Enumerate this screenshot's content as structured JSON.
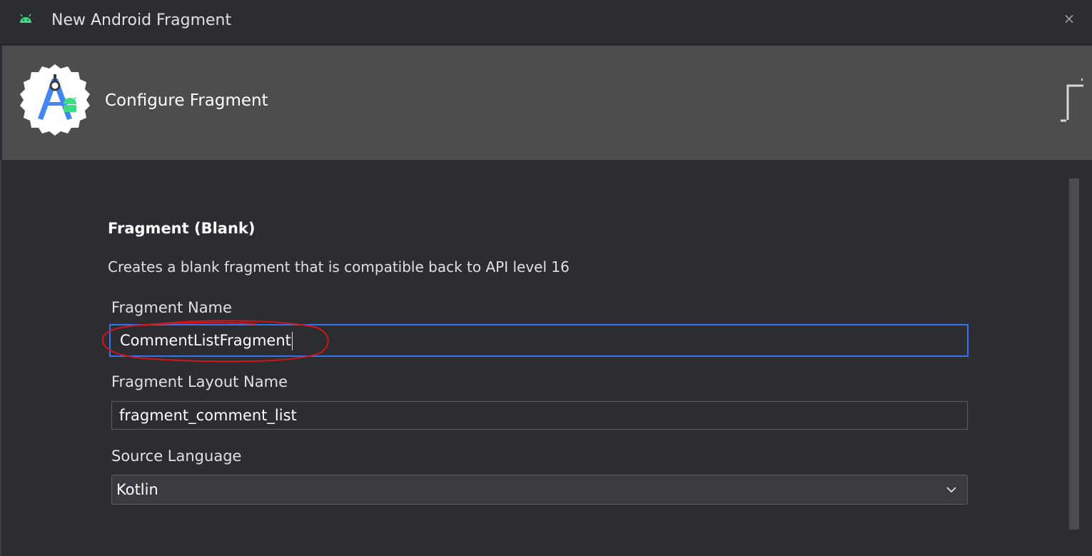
{
  "window": {
    "title": "New Android Fragment",
    "close_glyph": "×",
    "icon": "android-icon"
  },
  "banner": {
    "heading": "Configure Fragment",
    "logo": "android-studio-logo"
  },
  "template": {
    "title": "Fragment (Blank)",
    "description": "Creates a blank fragment that is compatible back to API level 16"
  },
  "form": {
    "fragment_name": {
      "label": "Fragment Name",
      "value": "CommentListFragment"
    },
    "layout_name": {
      "label": "Fragment Layout Name",
      "value": "fragment_comment_list"
    },
    "source_language": {
      "label": "Source Language",
      "selected": "Kotlin"
    }
  },
  "colors": {
    "background": "#2b2d30",
    "banner": "#4d4d4d",
    "focus": "#3574f0",
    "annotation": "#d0161b",
    "android_green": "#3ddc84"
  }
}
